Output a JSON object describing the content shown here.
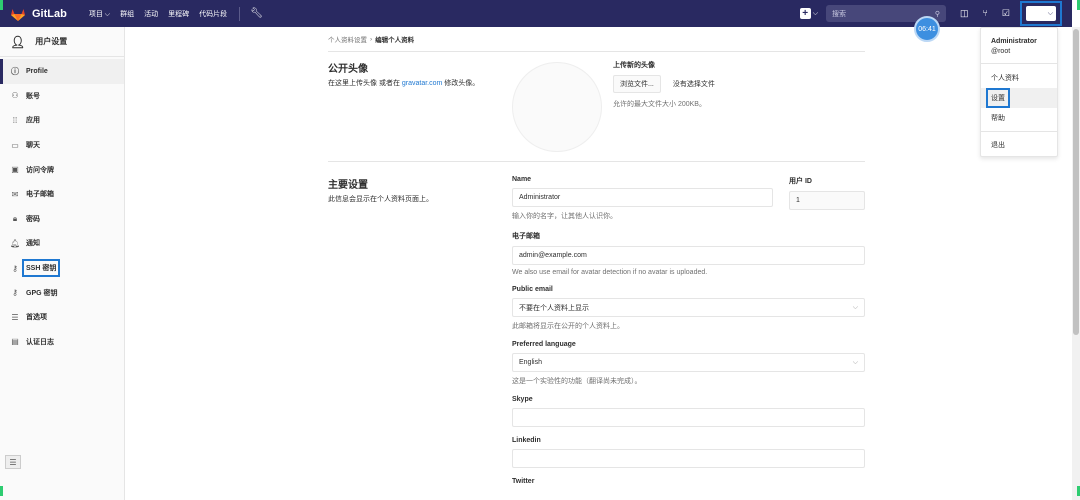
{
  "topbar": {
    "brand": "GitLab",
    "nav": [
      "项目 ⌵",
      "群组",
      "活动",
      "里程碑",
      "代码片段"
    ],
    "search_placeholder": "搜索",
    "timer": "06:41"
  },
  "sidebar": {
    "title": "用户设置",
    "items": [
      {
        "label": "Profile",
        "icon": "profile-icon"
      },
      {
        "label": "账号",
        "icon": "account-icon"
      },
      {
        "label": "应用",
        "icon": "applications-icon"
      },
      {
        "label": "聊天",
        "icon": "chat-icon"
      },
      {
        "label": "访问令牌",
        "icon": "token-icon"
      },
      {
        "label": "电子邮箱",
        "icon": "email-icon"
      },
      {
        "label": "密码",
        "icon": "lock-icon"
      },
      {
        "label": "通知",
        "icon": "bell-icon"
      },
      {
        "label": "SSH 密钥",
        "icon": "key-icon"
      },
      {
        "label": "GPG 密钥",
        "icon": "key-icon"
      },
      {
        "label": "首选项",
        "icon": "preferences-icon"
      },
      {
        "label": "认证日志",
        "icon": "log-icon"
      }
    ]
  },
  "breadcrumb": {
    "parent": "个人资料设置",
    "sep": "›",
    "current": "编辑个人资料"
  },
  "avatar": {
    "title": "公开头像",
    "desc_pre": "在这里上传头像 或者在 ",
    "desc_link": "gravatar.com",
    "desc_post": " 修改头像。",
    "upload_title": "上传新的头像",
    "browse_label": "浏览文件...",
    "no_file": "没有选择文件",
    "hint": "允许的最大文件大小 200KB。"
  },
  "main_settings": {
    "title": "主要设置",
    "desc": "此信息会显示在个人资料页面上。",
    "name_label": "Name",
    "name_value": "Administrator",
    "name_help": "输入你的名字，让其他人认识你。",
    "uid_label": "用户 ID",
    "uid_value": "1",
    "email_label": "电子邮箱",
    "email_value": "admin@example.com",
    "email_help": "We also use email for avatar detection if no avatar is uploaded.",
    "public_email_label": "Public email",
    "public_email_value": "不要在个人资料上显示",
    "public_email_help": "此邮箱将显示在公开的个人资料上。",
    "lang_label": "Preferred language",
    "lang_value": "English",
    "lang_help": "这是一个实验性的功能（翻译尚未完成）。",
    "skype_label": "Skype",
    "linkedin_label": "Linkedin",
    "twitter_label": "Twitter"
  },
  "user_menu": {
    "name": "Administrator",
    "handle": "@root",
    "items": [
      "个人资料",
      "设置",
      "帮助"
    ],
    "signout": "退出"
  },
  "colors": {
    "topbar": "#292961",
    "accent": "#1f78d1"
  }
}
